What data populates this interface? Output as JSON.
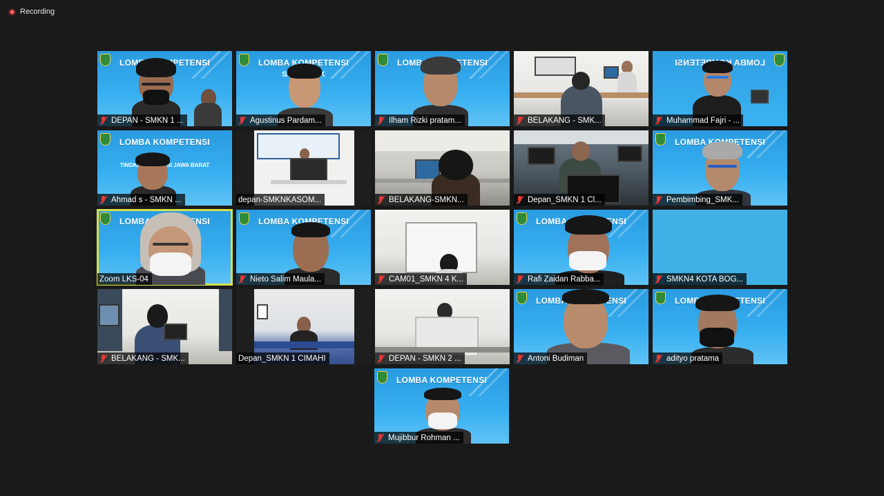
{
  "recording": {
    "label": "Recording"
  },
  "participants": [
    {
      "name": "DEPAN - SMKN 1 ...",
      "muted": true
    },
    {
      "name": "Agustinus Pardam...",
      "muted": true
    },
    {
      "name": "Ilham Rizki pratam...",
      "muted": true
    },
    {
      "name": "BELAKANG - SMK...",
      "muted": true
    },
    {
      "name": "Muhammad Fajri - ...",
      "muted": true
    },
    {
      "name": "Ahmad s - SMKN ...",
      "muted": true
    },
    {
      "name": "depan-SMKNKASOM...",
      "muted": false
    },
    {
      "name": "BELAKANG-SMKN...",
      "muted": true
    },
    {
      "name": "Depan_SMKN 1 Cl...",
      "muted": true
    },
    {
      "name": "Pembimbing_SMK...",
      "muted": true
    },
    {
      "name": "Zoom LKS-04",
      "muted": false
    },
    {
      "name": "Nieto Salim Maula...",
      "muted": true
    },
    {
      "name": "CAM01_SMKN 4 K...",
      "muted": true
    },
    {
      "name": "Rafi Zaidan Rabba...",
      "muted": true
    },
    {
      "name": "SMKN4 KOTA BOG...",
      "muted": true
    },
    {
      "name": "BELAKANG - SMK...",
      "muted": true
    },
    {
      "name": "Depan_SMKN 1 CIMAHI",
      "muted": false
    },
    {
      "name": "DEPAN - SMKN 2 ...",
      "muted": true
    },
    {
      "name": "Antoni Budiman",
      "muted": true
    },
    {
      "name": "adityo pratama",
      "muted": true
    },
    {
      "name": "Mujibbur Rohman ...",
      "muted": true
    }
  ],
  "banner": {
    "title": "LOMBA KOMPETENSI",
    "line2": "SISWA SMK",
    "line3": "TINGKAT PROVINSI JAWA BARAT"
  },
  "colors": {
    "background": "#1a1a1a",
    "active_speaker": "#d6e04a",
    "mute_icon": "#e53935",
    "recording_dot": "#e03535"
  }
}
